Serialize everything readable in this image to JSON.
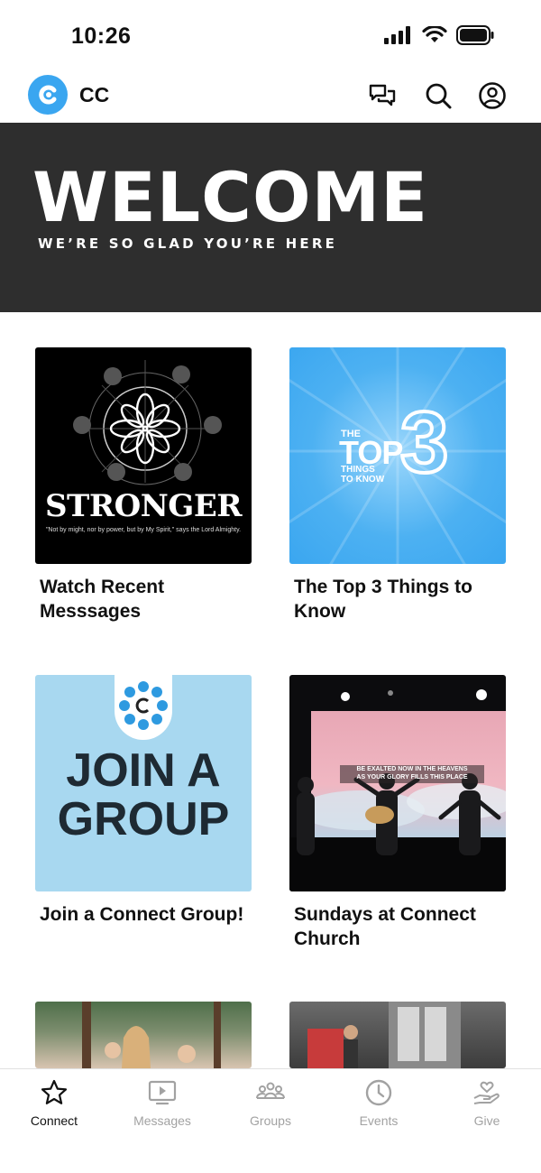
{
  "status_bar": {
    "time": "10:26"
  },
  "header": {
    "app_name": "CC"
  },
  "banner": {
    "title": "WELCOME",
    "subtitle": "WE’RE SO GLAD YOU’RE HERE"
  },
  "cards": [
    {
      "title": "Watch Recent Messsages",
      "image": {
        "headline": "STRONGER",
        "caption": "\"Not by might, nor by power, but by My Spirit,\" says the Lord Almighty."
      }
    },
    {
      "title": "The Top 3 Things to Know",
      "image": {
        "line1": "THE",
        "line2": "TOP",
        "digit": "3",
        "line3": "THINGS",
        "line4": "TO KNOW"
      }
    },
    {
      "title": "Join a Connect Group!",
      "image": {
        "line1": "JOIN A",
        "line2": "GROUP"
      }
    },
    {
      "title": "Sundays at Connect Church",
      "image": {
        "lyric1": "BE EXALTED NOW IN THE HEAVENS",
        "lyric2": "AS YOUR GLORY FILLS THIS PLACE"
      }
    }
  ],
  "tabs": [
    {
      "label": "Connect",
      "icon": "star-icon",
      "active": true
    },
    {
      "label": "Messages",
      "icon": "tv-play-icon",
      "active": false
    },
    {
      "label": "Groups",
      "icon": "people-icon",
      "active": false
    },
    {
      "label": "Events",
      "icon": "clock-icon",
      "active": false
    },
    {
      "label": "Give",
      "icon": "heart-hand-icon",
      "active": false
    }
  ],
  "colors": {
    "accent": "#3aa6f0",
    "banner_bg": "#2e2e2e",
    "tab_inactive": "#a2a2a2"
  }
}
